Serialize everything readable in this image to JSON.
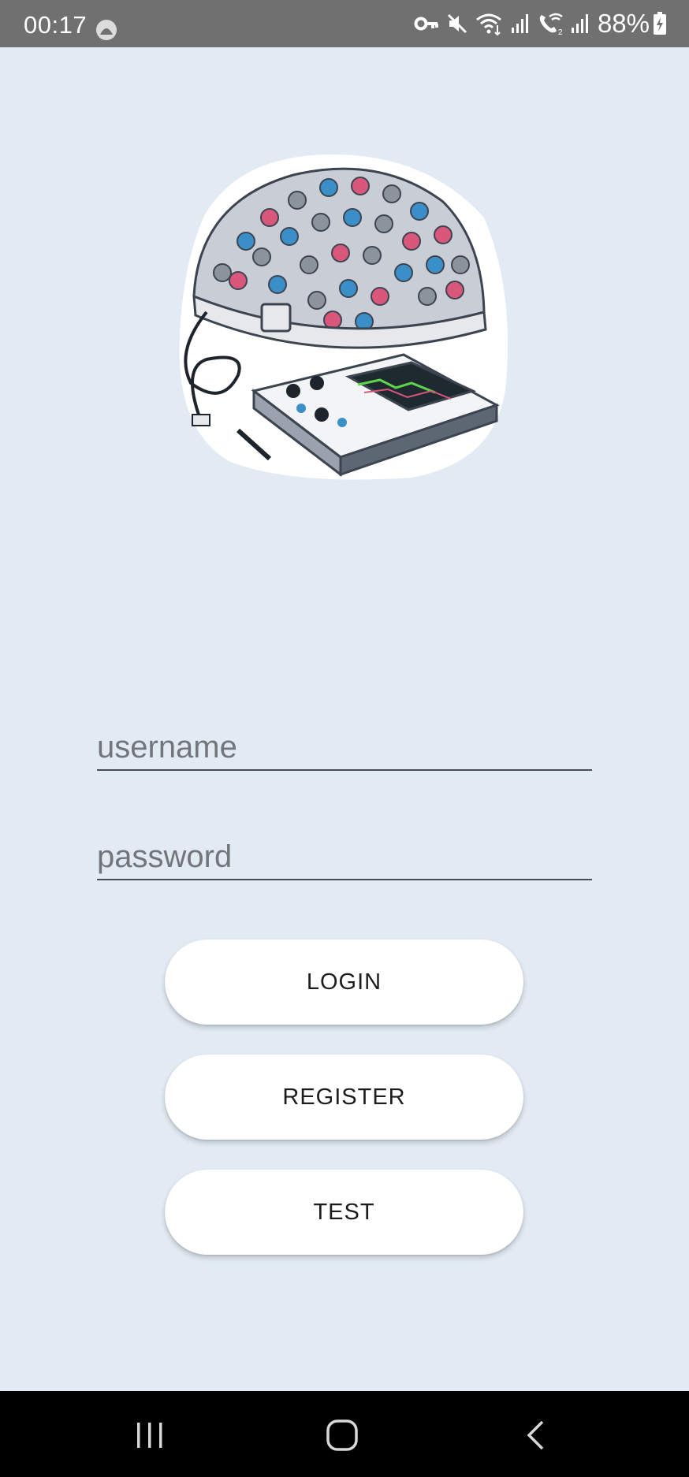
{
  "status_bar": {
    "time": "00:17",
    "battery": "88%",
    "icons": [
      "app-notification-icon",
      "vpn-key-icon",
      "mute-icon",
      "wifi-icon",
      "signal-icon",
      "wifi-calling-icon",
      "signal-icon",
      "battery-charging-icon"
    ]
  },
  "illustration": {
    "subject": "eeg-headset-with-monitor-illustration"
  },
  "form": {
    "username_placeholder": "username",
    "username_value": "",
    "password_placeholder": "password",
    "password_value": ""
  },
  "buttons": {
    "login": "LOGIN",
    "register": "REGISTER",
    "test": "TEST"
  },
  "nav_bar": {
    "icons": [
      "recent-apps-icon",
      "home-icon",
      "back-icon"
    ]
  },
  "colors": {
    "background": "#e2ebf3",
    "status_bar": "#707070",
    "button": "#ffffff",
    "nav_bar": "#000000"
  }
}
